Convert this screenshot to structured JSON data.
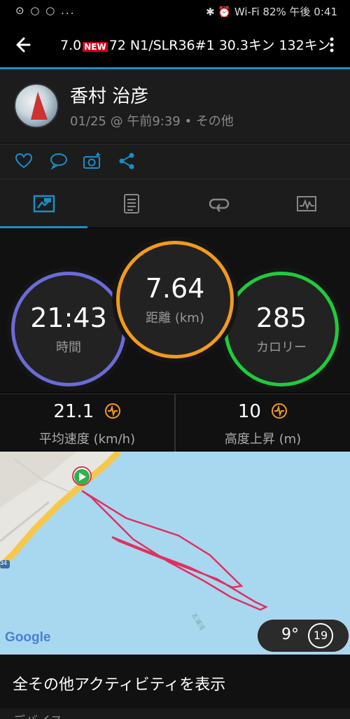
{
  "status_bar": {
    "left_icons": "⊙ ○ ○ ...",
    "right": "✱ ⏰ Wi-Fi 82% 午後 0:41"
  },
  "app_bar": {
    "title_prefix": "7.0",
    "new_badge": "NEW",
    "title_suffix": "72 N1/SLR36#1 30.3キン 132キン"
  },
  "profile": {
    "name": "香村 治彦",
    "subinfo": "01/25 @ 午前9:39 • その他"
  },
  "actions": {
    "like": "heart-icon",
    "comment": "comment-icon",
    "photo": "camera-add-icon",
    "share": "share-icon"
  },
  "tabs": [
    {
      "name": "summary",
      "icon": "flag-chart-icon"
    },
    {
      "name": "laps",
      "icon": "list-icon"
    },
    {
      "name": "splits",
      "icon": "loop-icon"
    },
    {
      "name": "graphs",
      "icon": "graph-icon"
    }
  ],
  "stats": {
    "time": {
      "value": "21:43",
      "label": "時間",
      "color": "#6b6bd8"
    },
    "distance": {
      "value": "7.64",
      "label": "距離 (km)",
      "color": "#f39a1e"
    },
    "calories": {
      "value": "285",
      "label": "カロリー",
      "color": "#1ecc3c"
    }
  },
  "metrics": {
    "avg_speed": {
      "value": "21.1",
      "label": "平均速度 (km/h)"
    },
    "elevation": {
      "value": "10",
      "label": "高度上昇 (m)"
    }
  },
  "map": {
    "logo": "Google",
    "route_badge": "34",
    "place_label": "五浦湾",
    "weather_temp": "9°",
    "wind_speed": "19"
  },
  "more": {
    "label": "全その他アクティビティを表示"
  },
  "device": {
    "label": "デバイス"
  }
}
